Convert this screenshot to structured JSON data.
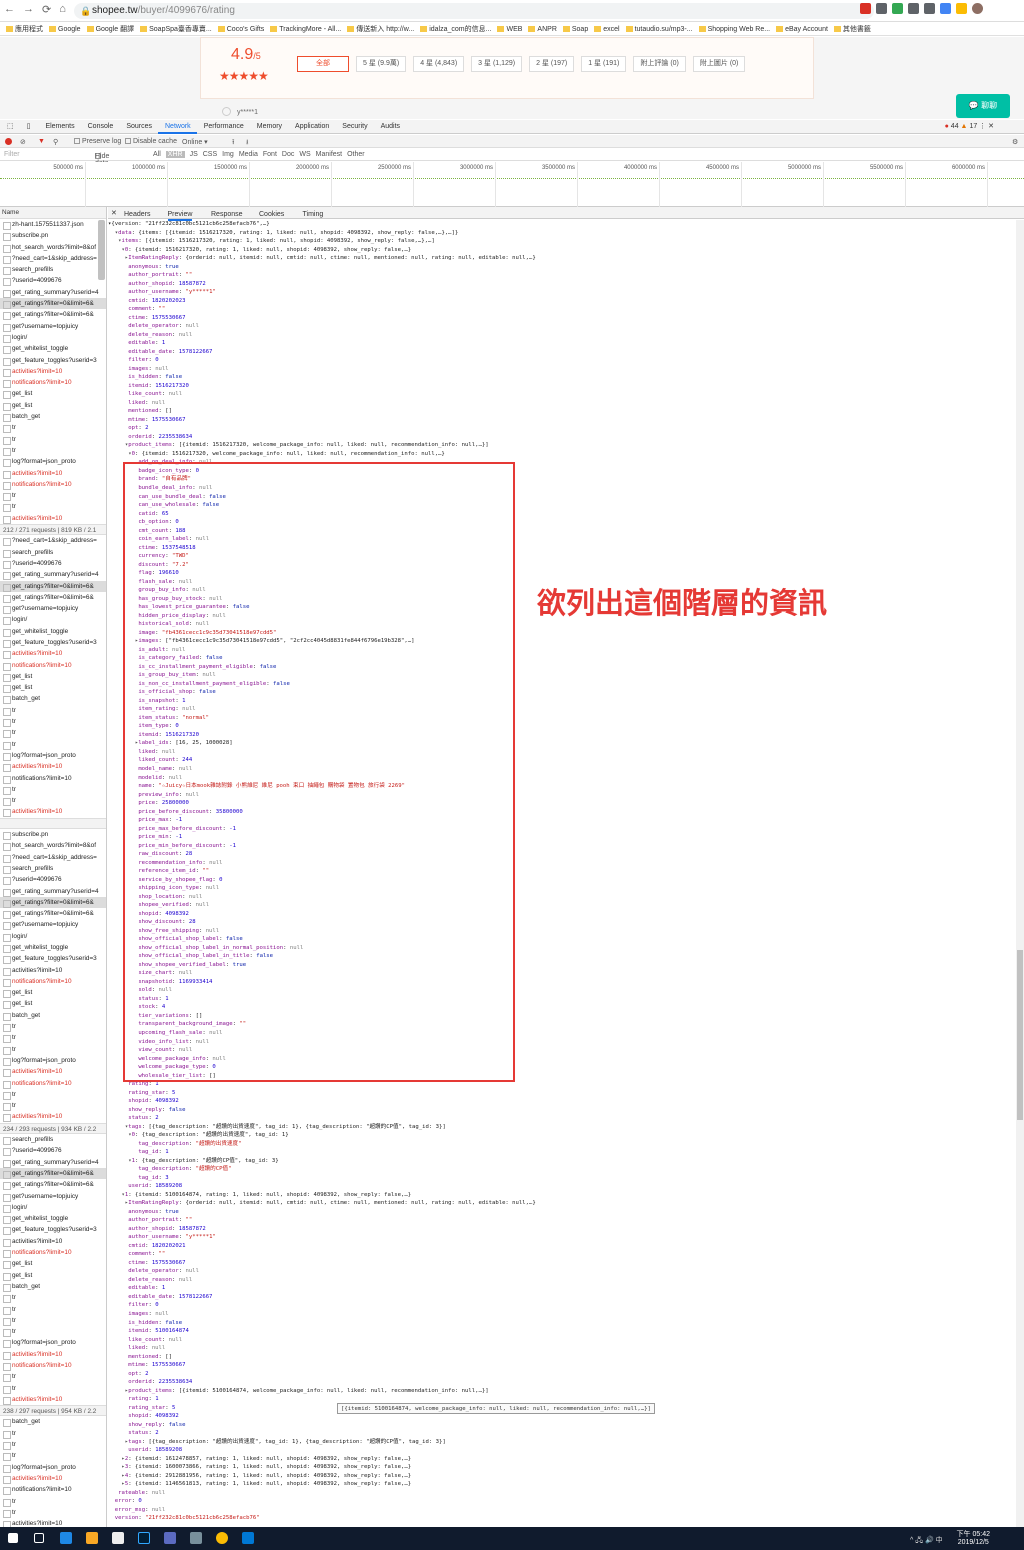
{
  "browser": {
    "url_host": "shopee.tw",
    "url_path": "/buyer/4099676/rating",
    "nav": [
      "←",
      "→",
      "⟳",
      "⌂"
    ],
    "bookmarks": [
      "應用程式",
      "Google",
      "Google 翻譯",
      "SoapSpa臺香專賣...",
      "Coco's Gifts",
      "TrackingMore - All...",
      "傳送新入 http://w...",
      "idalza_com的信息...",
      "WEB",
      "ANPR",
      "Soap",
      "excel",
      "tutaudio.su/mp3-...",
      "Shopping Web Re...",
      "eBay Account",
      "其他書籤"
    ]
  },
  "rating_card": {
    "score": "4.9",
    "score_suffix": "/5",
    "stars": "★★★★★",
    "filters": [
      "全部",
      "5 星 (9.9萬)",
      "4 星 (4,843)",
      "3 星 (1,129)",
      "2 星 (197)",
      "1 星 (191)",
      "附上評論 (0)",
      "附上圖片 (0)"
    ],
    "reviewer": "y*****1",
    "chat_label": "聊聊"
  },
  "devtools": {
    "tabs": [
      "Elements",
      "Console",
      "Sources",
      "Network",
      "Performance",
      "Memory",
      "Application",
      "Security",
      "Audits"
    ],
    "active_tab": "Network",
    "errors": "44",
    "warnings": "17",
    "toolbar": {
      "preserve": "Preserve log",
      "cache": "Disable cache",
      "online": "Online"
    },
    "filter": {
      "placeholder": "Filter",
      "hide": "Hide data URLs",
      "types": [
        "All",
        "XHR",
        "JS",
        "CSS",
        "Img",
        "Media",
        "Font",
        "Doc",
        "WS",
        "Manifest",
        "Other"
      ]
    },
    "ticks": [
      "500000 ms",
      "1000000 ms",
      "1500000 ms",
      "2000000 ms",
      "2500000 ms",
      "3000000 ms",
      "3500000 ms",
      "4000000 ms",
      "4500000 ms",
      "5000000 ms",
      "5500000 ms",
      "6000000 ms"
    ],
    "name_header": "Name",
    "preview_tabs": [
      "Headers",
      "Preview",
      "Response",
      "Cookies",
      "Timing"
    ],
    "summaries": [
      "212 / 271 requests  |  819 KB / 2.1",
      "234 / 293 requests  |  934 KB / 2.2",
      "238 / 297 requests  |  954 KB / 2.2",
      "242 / 301 requests  |  975 KB / 2.2"
    ]
  },
  "requests": [
    "zh-hant.1575511337.json",
    "subscribe.pn",
    "hot_search_words?limit=8&of",
    "?need_cart=1&skip_address=",
    "search_prefills",
    "?userid=4099676",
    "get_rating_summary?userid=4",
    "get_ratings?filter=0&limit=6&",
    "get_ratings?filter=0&limit=6&",
    "get?username=topjuicy",
    "login/",
    "get_whitelist_toggle",
    "get_feature_toggles?userid=3",
    "activities?limit=10",
    "notifications?limit=10",
    "get_list",
    "get_list",
    "batch_get",
    "tr",
    "tr",
    "tr",
    "log?format=json_proto",
    "activities?limit=10",
    "notifications?limit=10",
    "tr",
    "tr",
    "activities?limit=10"
  ],
  "requests2": [
    "?need_cart=1&skip_address=",
    "search_prefills",
    "?userid=4099676",
    "get_rating_summary?userid=4",
    "get_ratings?filter=0&limit=6&",
    "get_ratings?filter=0&limit=6&",
    "get?username=topjuicy",
    "login/",
    "get_whitelist_toggle",
    "get_feature_toggles?userid=3",
    "activities?limit=10",
    "notifications?limit=10",
    "get_list",
    "get_list",
    "batch_get",
    "tr",
    "tr",
    "tr",
    "tr",
    "log?format=json_proto",
    "activities?limit=10",
    "notifications?limit=10",
    "tr",
    "tr",
    "activities?limit=10"
  ],
  "requests3": [
    "subscribe.pn",
    "hot_search_words?limit=8&of",
    "?need_cart=1&skip_address=",
    "search_prefills",
    "?userid=4099676",
    "get_rating_summary?userid=4",
    "get_ratings?filter=0&limit=6&",
    "get_ratings?filter=0&limit=6&",
    "get?username=topjuicy",
    "login/",
    "get_whitelist_toggle",
    "get_feature_toggles?userid=3",
    "activities?limit=10",
    "notifications?limit=10",
    "get_list",
    "get_list",
    "batch_get",
    "tr",
    "tr",
    "tr",
    "log?format=json_proto",
    "activities?limit=10",
    "notifications?limit=10",
    "tr",
    "tr",
    "activities?limit=10"
  ],
  "requests4": [
    "search_prefills",
    "?userid=4099676",
    "get_rating_summary?userid=4",
    "get_ratings?filter=0&limit=6&",
    "get_ratings?filter=0&limit=6&",
    "get?username=topjuicy",
    "login/",
    "get_whitelist_toggle",
    "get_feature_toggles?userid=3",
    "activities?limit=10",
    "notifications?limit=10",
    "get_list",
    "get_list",
    "batch_get",
    "tr",
    "tr",
    "tr",
    "tr",
    "log?format=json_proto",
    "activities?limit=10",
    "notifications?limit=10",
    "tr",
    "tr",
    "activities?limit=10"
  ],
  "requests5": [
    "batch_get",
    "tr",
    "tr",
    "tr",
    "log?format=json_proto",
    "activities?limit=10",
    "notifications?limit=10",
    "tr",
    "tr",
    "activities?limit=10"
  ],
  "json_lines": [
    "▾{version: \"21ff232c81c0bc5121cb6c258efacb76\",…}",
    "  ▾data: {items: [{itemid: 1516217320, rating: 1, liked: null, shopid: 4098392, show_reply: false,…},…]}",
    "   ▾items: [{itemid: 1516217320, rating: 1, liked: null, shopid: 4098392, show_reply: false,…},…]",
    "    ▾0: {itemid: 1516217320, rating: 1, liked: null, shopid: 4098392, show_reply: false,…}",
    "     ▸ItemRatingReply: {orderid: null, itemid: null, cmtid: null, ctime: null, mentioned: null, rating: null, editable: null,…}",
    "      anonymous: true",
    "      author_portrait: \"\"",
    "      author_shopid: 18587872",
    "      author_username: \"y*****1\"",
    "      cmtid: 1820202023",
    "      comment: \"\"",
    "      ctime: 1575530667",
    "      delete_operator: null",
    "      delete_reason: null",
    "      editable: 1",
    "      editable_date: 1578122667",
    "      filter: 0",
    "      images: null",
    "      is_hidden: false",
    "      itemid: 1516217320",
    "      like_count: null",
    "      liked: null",
    "      mentioned: []",
    "      mtime: 1575530667",
    "      opt: 2",
    "      orderid: 2235538634",
    "     ▾product_items: [{itemid: 1516217320, welcome_package_info: null, liked: null, recommendation_info: null,…}]",
    "      ▾0: {itemid: 1516217320, welcome_package_info: null, liked: null, recommendation_info: null,…}",
    "         add_on_deal_info: null",
    "         badge_icon_type: 0",
    "         brand: \"自有品牌\"",
    "         bundle_deal_info: null",
    "         can_use_bundle_deal: false",
    "         can_use_wholesale: false",
    "         catid: 65",
    "         cb_option: 0",
    "         cmt_count: 188",
    "         coin_earn_label: null",
    "         ctime: 1537548518",
    "         currency: \"TWD\"",
    "         discount: \"7.2\"",
    "         flag: 196610",
    "         flash_sale: null",
    "         group_buy_info: null",
    "         has_group_buy_stock: null",
    "         has_lowest_price_guarantee: false",
    "         hidden_price_display: null",
    "         historical_sold: null",
    "         image: \"fb4361cecc1c9c35d73041518e97cdd5\"",
    "        ▸images: [\"fb4361cecc1c9c35d73041518e97cdd5\", \"2cf2cc4045d8831fe844f6796e19b328\",…]",
    "         is_adult: null",
    "         is_category_failed: false",
    "         is_cc_installment_payment_eligible: false",
    "         is_group_buy_item: null",
    "         is_non_cc_installment_payment_eligible: false",
    "         is_official_shop: false",
    "         is_snapshot: 1",
    "         item_rating: null",
    "         item_status: \"normal\"",
    "         item_type: 0",
    "         itemid: 1516217320",
    "        ▸label_ids: [16, 25, 1000028]",
    "         liked: null",
    "         liked_count: 244",
    "         model_name: null",
    "         modelid: null",
    "         name: \"☆Juicy☆日本mook雜誌附錄 小熊維尼 維尼 pooh 束口 抽繩包 購物袋 置物包 旅行袋 2269\"",
    "         preview_info: null",
    "         price: 25800000",
    "         price_before_discount: 35800000",
    "         price_max: -1",
    "         price_max_before_discount: -1",
    "         price_min: -1",
    "         price_min_before_discount: -1",
    "         raw_discount: 28",
    "         recommendation_info: null",
    "         reference_item_id: \"\"",
    "         service_by_shopee_flag: 0",
    "         shipping_icon_type: null",
    "         shop_location: null",
    "         shopee_verified: null",
    "         shopid: 4098392",
    "         show_discount: 28",
    "         show_free_shipping: null",
    "         show_official_shop_label: false",
    "         show_official_shop_label_in_normal_position: null",
    "         show_official_shop_label_in_title: false",
    "         show_shopee_verified_label: true",
    "         size_chart: null",
    "         snapshotid: 1169933414",
    "         sold: null",
    "         status: 1",
    "         stock: 4",
    "         tier_variations: []",
    "         transparent_background_image: \"\"",
    "         upcoming_flash_sale: null",
    "         video_info_list: null",
    "         view_count: null",
    "         welcome_package_info: null",
    "         welcome_package_type: 0",
    "         wholesale_tier_list: []",
    "      rating: 1",
    "      rating_star: 5",
    "      shopid: 4098392",
    "      show_reply: false",
    "      status: 2",
    "     ▾tags: [{tag_description: \"超讚的出貨速度\", tag_id: 1}, {tag_description: \"超讚的CP值\", tag_id: 3}]",
    "      ▾0: {tag_description: \"超讚的出貨速度\", tag_id: 1}",
    "         tag_description: \"超讚的出貨速度\"",
    "         tag_id: 1",
    "      ▾1: {tag_description: \"超讚的CP值\", tag_id: 3}",
    "         tag_description: \"超讚的CP值\"",
    "         tag_id: 3",
    "      userid: 18589208",
    "    ▾1: {itemid: 5100164874, rating: 1, liked: null, shopid: 4098392, show_reply: false,…}",
    "     ▸ItemRatingReply: {orderid: null, itemid: null, cmtid: null, ctime: null, mentioned: null, rating: null, editable: null,…}",
    "      anonymous: true",
    "      author_portrait: \"\"",
    "      author_shopid: 18587872",
    "      author_username: \"y*****1\"",
    "      cmtid: 1820202021",
    "      comment: \"\"",
    "      ctime: 1575530667",
    "      delete_operator: null",
    "      delete_reason: null",
    "      editable: 1",
    "      editable_date: 1578122667",
    "      filter: 0",
    "      images: null",
    "      is_hidden: false",
    "      itemid: 5100164874",
    "      like_count: null",
    "      liked: null",
    "      mentioned: []",
    "      mtime: 1575530667",
    "      opt: 2",
    "      orderid: 2235538634",
    "     ▸product_items: [{itemid: 5100164874, welcome_package_info: null, liked: null, recommendation_info: null,…}]",
    "      rating: 1",
    "      rating_star: 5",
    "      shopid: 4098392",
    "      show_reply: false",
    "      status: 2",
    "     ▸tags: [{tag_description: \"超讚的出貨速度\", tag_id: 1}, {tag_description: \"超讚的CP值\", tag_id: 3}]",
    "      userid: 18589208",
    "    ▸2: {itemid: 1612478857, rating: 1, liked: null, shopid: 4098392, show_reply: false,…}",
    "    ▸3: {itemid: 1600073866, rating: 1, liked: null, shopid: 4098392, show_reply: false,…}",
    "    ▸4: {itemid: 2912881956, rating: 1, liked: null, shopid: 4098392, show_reply: false,…}",
    "    ▸5: {itemid: 1146561813, rating: 1, liked: null, shopid: 4098392, show_reply: false,…}",
    "   rateable: null",
    "  error: 0",
    "  error_msg: null",
    "  version: \"21ff232c81c0bc5121cb6c258efacb76\""
  ],
  "annotation": "欲列出這個階層的資訊",
  "tooltip": "[{itemid: 5100164874, welcome_package_info: null, liked: null, recommendation_info: null,…}]",
  "clock": {
    "time": "下午 05:42",
    "date": "2019/12/5"
  },
  "colors": {
    "accent": "#ee4d2d",
    "highlight": "#e53935",
    "chat": "#00bfa5",
    "taskbar": "#101b2d"
  }
}
